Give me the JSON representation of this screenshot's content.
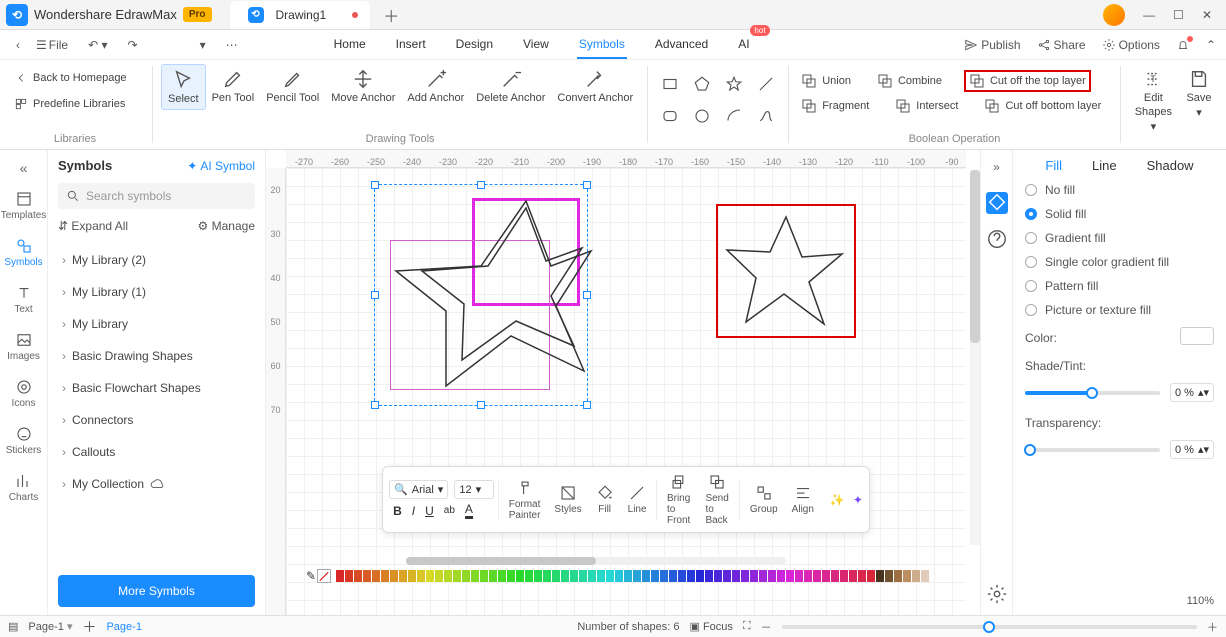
{
  "app": {
    "name": "Wondershare EdrawMax",
    "pro": "Pro"
  },
  "tab": {
    "name": "Drawing1"
  },
  "menubar": {
    "file": "File",
    "tabs": [
      "Home",
      "Insert",
      "Design",
      "View",
      "Symbols",
      "Advanced",
      "AI"
    ],
    "active": "Symbols",
    "publish": "Publish",
    "share": "Share",
    "options": "Options"
  },
  "ribbon": {
    "back": "Back to Homepage",
    "predef": "Predefine Libraries",
    "libraries": "Libraries",
    "select": "Select",
    "pen": "Pen Tool",
    "pencil": "Pencil Tool",
    "move": "Move Anchor",
    "add": "Add Anchor",
    "delete": "Delete Anchor",
    "convert": "Convert Anchor",
    "drawing": "Drawing Tools",
    "union": "Union",
    "combine": "Combine",
    "cuttop": "Cut off the top layer",
    "fragment": "Fragment",
    "intersect": "Intersect",
    "cutbottom": "Cut off bottom layer",
    "boolean": "Boolean Operation",
    "edit": "Edit",
    "shapes": "Shapes",
    "save": "Save"
  },
  "leftrail": {
    "templates": "Templates",
    "symbols": "Symbols",
    "text": "Text",
    "images": "Images",
    "icons": "Icons",
    "stickers": "Stickers",
    "charts": "Charts"
  },
  "sidepanel": {
    "title": "Symbols",
    "ai": "AI Symbol",
    "search": "Search symbols",
    "expand": "Expand All",
    "manage": "Manage",
    "items": [
      "My Library (2)",
      "My Library (1)",
      "My Library",
      "Basic Drawing Shapes",
      "Basic Flowchart Shapes",
      "Connectors",
      "Callouts",
      "My Collection"
    ],
    "more": "More Symbols"
  },
  "ruler_h": [
    "-270",
    "-260",
    "-250",
    "-240",
    "-230",
    "-220",
    "-210",
    "-200",
    "-190",
    "-180",
    "-170",
    "-160",
    "-150",
    "-140",
    "-130",
    "-120",
    "-110",
    "-100",
    "-90"
  ],
  "ruler_v": [
    "20",
    "30",
    "40",
    "50",
    "60",
    "70"
  ],
  "float": {
    "font": "Arial",
    "size": "12",
    "format": "Format Painter",
    "styles": "Styles",
    "fill": "Fill",
    "line": "Line",
    "front": "Bring to Front",
    "back": "Send to Back",
    "group": "Group",
    "align": "Align"
  },
  "rightpanel": {
    "tabs": [
      "Fill",
      "Line",
      "Shadow"
    ],
    "active": "Fill",
    "nofill": "No fill",
    "solid": "Solid fill",
    "gradient": "Gradient fill",
    "single": "Single color gradient fill",
    "pattern": "Pattern fill",
    "texture": "Picture or texture fill",
    "color": "Color:",
    "shade": "Shade/Tint:",
    "transparency": "Transparency:",
    "pct0": "0 %",
    "zoom": "110%"
  },
  "status": {
    "page": "Page-1",
    "page_active": "Page-1",
    "shapes": "Number of shapes: 6",
    "focus": "Focus"
  }
}
